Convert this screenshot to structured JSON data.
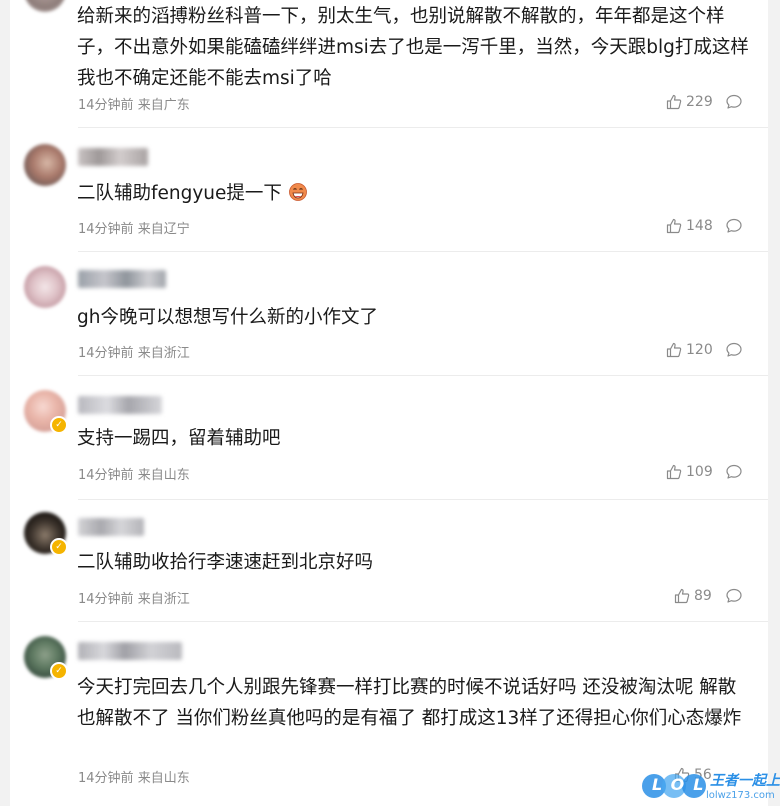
{
  "comments": [
    {
      "text": "给新来的滔搏粉丝科普一下，别太生气，也别说解散不解散的，年年都是这个样子，不出意外如果能磕磕绊绊进msi去了也是一泻千里，当然，今天跟blg打成这样我也不确定还能不能去msi了哈",
      "time": "14分钟前",
      "location": "来自广东",
      "likes": "229"
    },
    {
      "text": "二队辅助fengyue提一下",
      "emoji": "laughing-face-emoji",
      "time": "14分钟前",
      "location": "来自辽宁",
      "likes": "148"
    },
    {
      "text": "gh今晚可以想想写什么新的小作文了",
      "time": "14分钟前",
      "location": "来自浙江",
      "likes": "120"
    },
    {
      "text": "支持一踢四，留着辅助吧",
      "time": "14分钟前",
      "location": "来自山东",
      "likes": "109"
    },
    {
      "text": "二队辅助收拾行李速速赶到北京好吗",
      "time": "14分钟前",
      "location": "来自浙江",
      "likes": "89"
    },
    {
      "text": "今天打完回去几个人别跟先锋赛一样打比赛的时候不说话好吗 还没被淘汰呢 解散也解散不了 当你们粉丝真他吗的是有福了 都打成这13样了还得担心你们心态爆炸",
      "time": "14分钟前",
      "location": "来自山东",
      "likes": "56"
    }
  ],
  "watermark": {
    "logo": "LOL",
    "name": "王者一起上",
    "url": "lolwz173.com"
  },
  "icons": {
    "like": "thumbs-up-icon",
    "reply": "comment-bubble-icon"
  }
}
